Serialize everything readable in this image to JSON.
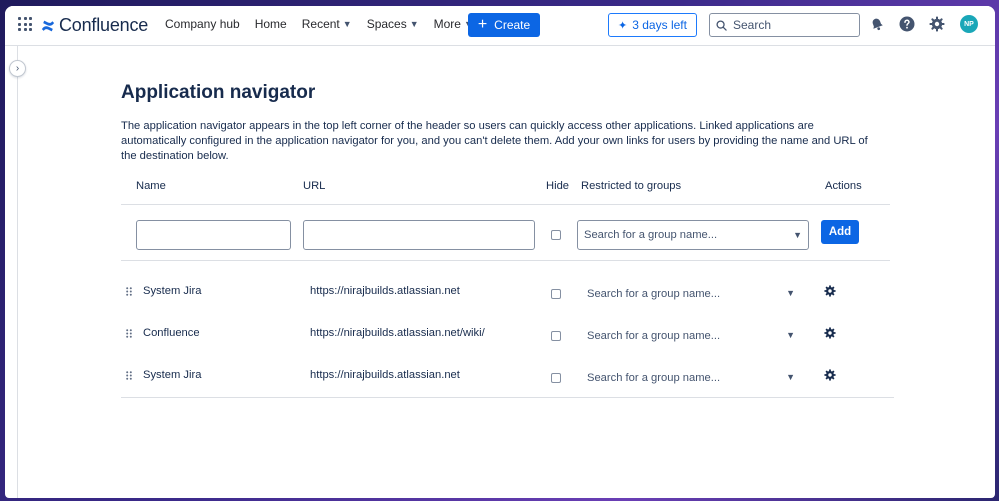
{
  "header": {
    "brand": "Confluence",
    "nav": [
      {
        "label": "Company hub",
        "dropdown": false
      },
      {
        "label": "Home",
        "dropdown": false
      },
      {
        "label": "Recent",
        "dropdown": true
      },
      {
        "label": "Spaces",
        "dropdown": true
      },
      {
        "label": "More",
        "dropdown": true
      }
    ],
    "create_label": "Create",
    "trial_label": "3 days left",
    "search_placeholder": "Search",
    "avatar_initials": "NP",
    "accent": "#0c66e4"
  },
  "page": {
    "title": "Application navigator",
    "description": "The application navigator appears in the top left corner of the header so users can quickly access other applications. Linked applications are automatically configured in the application navigator for you, and you can't delete them. Add your own links for users by providing the name and URL of the destination below."
  },
  "table": {
    "columns": {
      "name": "Name",
      "url": "URL",
      "hide": "Hide",
      "groups": "Restricted to groups",
      "actions": "Actions"
    },
    "new_row": {
      "name_value": "",
      "url_value": "",
      "group_placeholder": "Search for a group name...",
      "add_label": "Add"
    },
    "rows": [
      {
        "name": "System Jira",
        "url": "https://nirajbuilds.atlassian.net",
        "group_placeholder": "Search for a group name..."
      },
      {
        "name": "Confluence",
        "url": "https://nirajbuilds.atlassian.net/wiki/",
        "group_placeholder": "Search for a group name..."
      },
      {
        "name": "System Jira",
        "url": "https://nirajbuilds.atlassian.net",
        "group_placeholder": "Search for a group name..."
      }
    ]
  }
}
